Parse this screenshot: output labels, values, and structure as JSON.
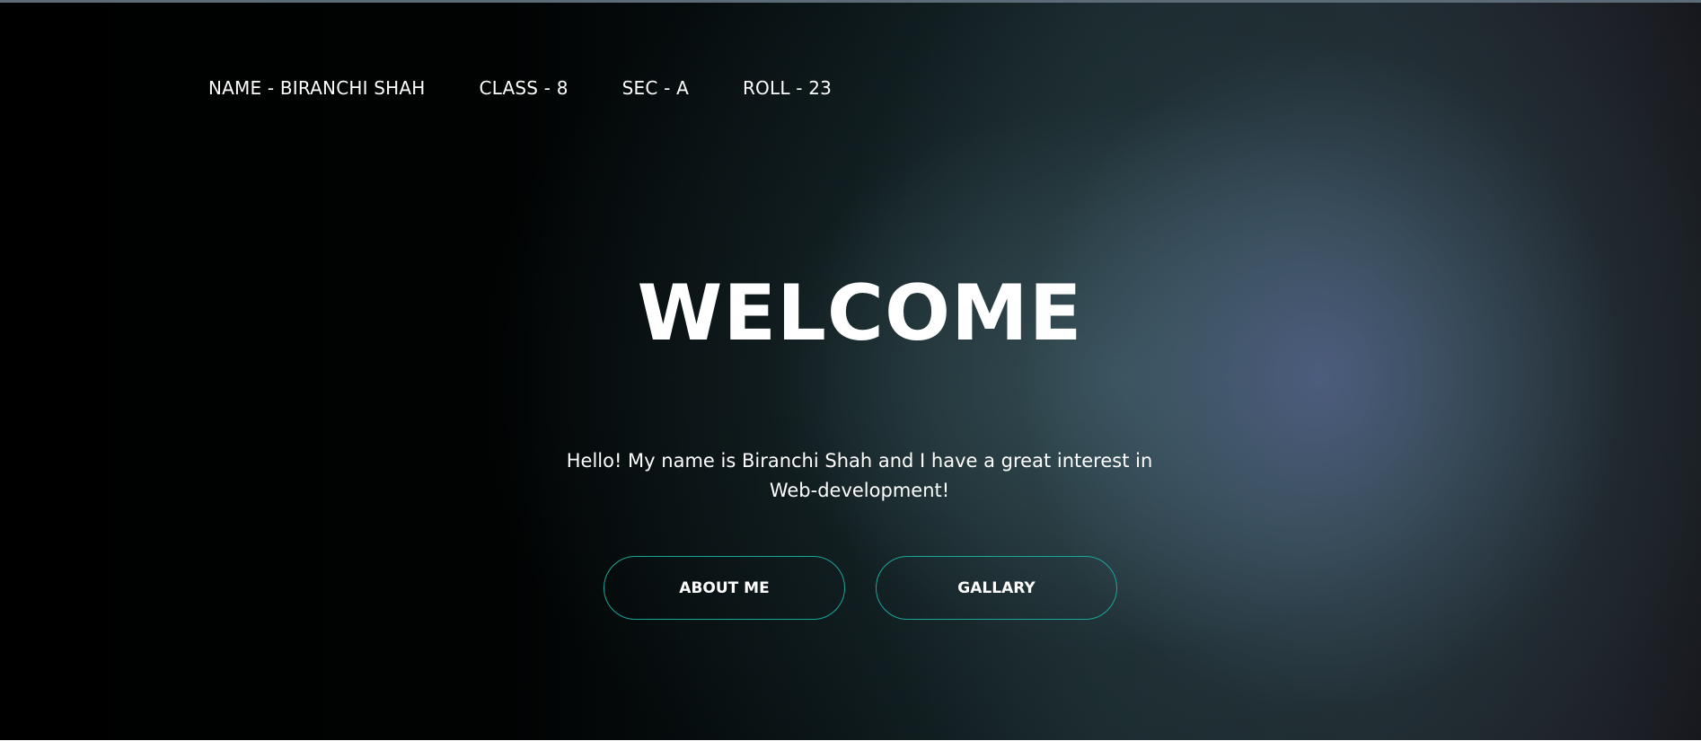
{
  "nav": {
    "name": "NAME - BIRANCHI SHAH",
    "class": "CLASS - 8",
    "section": "SEC - A",
    "roll": "ROLL - 23"
  },
  "hero": {
    "title": "WELCOME",
    "intro_line1": "Hello! My name is Biranchi Shah and I have a great interest in",
    "intro_line2": "Web-development!"
  },
  "buttons": {
    "about_label": "ABOUT ME",
    "gallery_label": "GALLARY"
  },
  "colors": {
    "button_border": "#17a89a",
    "text": "#ffffff",
    "background_dark": "#000000",
    "glow": "#4a5a78"
  }
}
